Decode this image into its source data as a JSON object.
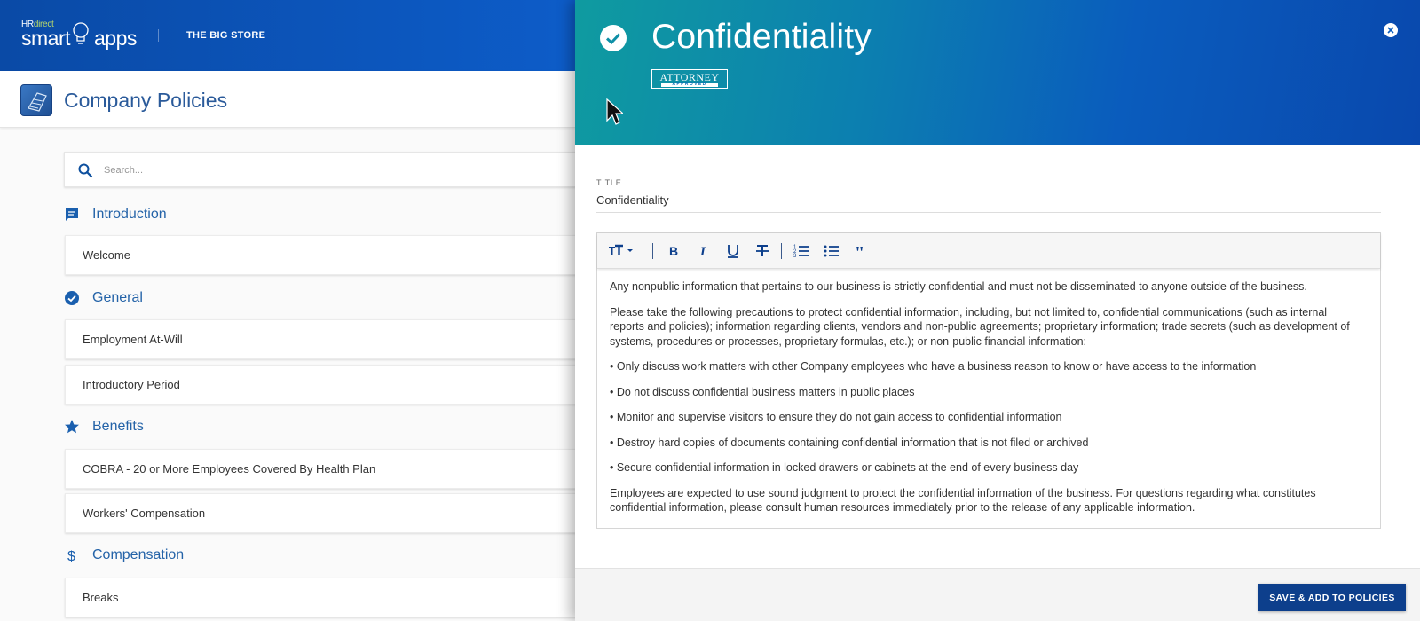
{
  "brand": {
    "hr_prefix": "HR",
    "hr_suffix": "direct",
    "smart": "smart",
    "apps": "apps"
  },
  "store_name": "THE BIG STORE",
  "page_title": "Company Policies",
  "search": {
    "placeholder": "Search..."
  },
  "sections": [
    {
      "label": "Introduction",
      "icon": "chat-bubble-icon",
      "items": [
        "Welcome"
      ]
    },
    {
      "label": "General",
      "icon": "check-circle-icon",
      "items": [
        "Employment At-Will",
        "Introductory Period"
      ]
    },
    {
      "label": "Benefits",
      "icon": "star-icon",
      "items": [
        "COBRA - 20 or More Employees Covered By Health Plan",
        "Workers' Compensation"
      ]
    },
    {
      "label": "Compensation",
      "icon": "dollar-icon",
      "items": [
        "Breaks"
      ]
    }
  ],
  "drawer": {
    "title": "Confidentiality",
    "badge_top": "ATTORNEY",
    "badge_bottom": "APPROVED",
    "field_label": "TITLE",
    "field_value": "Confidentiality",
    "body": [
      "Any nonpublic information that pertains to our business is strictly confidential and must not be disseminated to anyone outside of the business.",
      "Please take the following precautions to protect confidential information, including, but not limited to, confidential communications (such as internal reports and policies); information regarding clients, vendors and non-public agreements; proprietary information; trade secrets (such as development of systems, procedures or processes, proprietary formulas, etc.); or non-public financial information:",
      "• Only discuss work matters with other Company employees who have a business reason to know or have access to the information",
      "• Do not discuss confidential business matters in public places",
      "• Monitor and supervise visitors to ensure they do not gain access to confidential information",
      "• Destroy hard copies of documents containing confidential information that is not filed or archived",
      "• Secure confidential information in locked drawers or cabinets at the end of every business day",
      "Employees are expected to use sound judgment to protect the confidential information of the business.  For questions regarding what constitutes confidential information, please consult human resources immediately prior to the release of any applicable information."
    ],
    "save_label": "SAVE & ADD TO POLICIES"
  },
  "colors": {
    "header_blue": "#0d5cc8",
    "accent": "#2463a8",
    "save_button": "#0d3f8c"
  }
}
